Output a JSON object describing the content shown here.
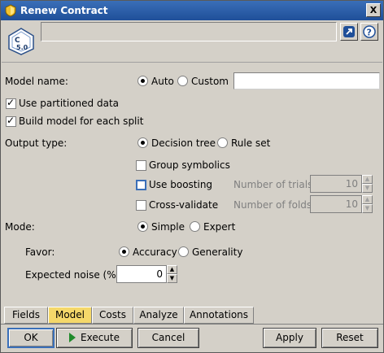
{
  "window": {
    "title": "Renew Contract",
    "close_label": "X"
  },
  "header": {
    "node_icon_text": "5.0",
    "node_icon_letter": "C",
    "annotation_value": "",
    "launch_icon": "launch-icon",
    "help_icon": "help-icon",
    "help_label": "?"
  },
  "form": {
    "model_name_label": "Model name:",
    "model_name_auto": "Auto",
    "model_name_custom": "Custom",
    "model_name_value": "",
    "model_name_selected": "Auto",
    "use_partitioned_label": "Use partitioned data",
    "use_partitioned_checked": true,
    "build_each_split_label": "Build model for each split",
    "build_each_split_checked": true,
    "output_type_label": "Output type:",
    "output_type_decision": "Decision tree",
    "output_type_rule": "Rule set",
    "output_type_selected": "Decision tree",
    "group_symbolics_label": "Group symbolics",
    "group_symbolics_checked": false,
    "use_boosting_label": "Use boosting",
    "use_boosting_checked": false,
    "num_trials_label": "Number of trials:",
    "num_trials_value": "10",
    "cross_validate_label": "Cross-validate",
    "cross_validate_checked": false,
    "num_folds_label": "Number of folds:",
    "num_folds_value": "10",
    "mode_label": "Mode:",
    "mode_simple": "Simple",
    "mode_expert": "Expert",
    "mode_selected": "Simple",
    "favor_label": "Favor:",
    "favor_accuracy": "Accuracy",
    "favor_generality": "Generality",
    "favor_selected": "Accuracy",
    "expected_noise_label": "Expected noise (%):",
    "expected_noise_value": "0"
  },
  "tabs": [
    {
      "label": "Fields",
      "active": false
    },
    {
      "label": "Model",
      "active": true
    },
    {
      "label": "Costs",
      "active": false
    },
    {
      "label": "Analyze",
      "active": false
    },
    {
      "label": "Annotations",
      "active": false
    }
  ],
  "buttons": {
    "ok": "OK",
    "execute": "Execute",
    "cancel": "Cancel",
    "apply": "Apply",
    "reset": "Reset"
  },
  "colors": {
    "title_bar": "#2a5fa8",
    "active_tab": "#f5d86a",
    "execute_icon": "#1e8a2a"
  }
}
